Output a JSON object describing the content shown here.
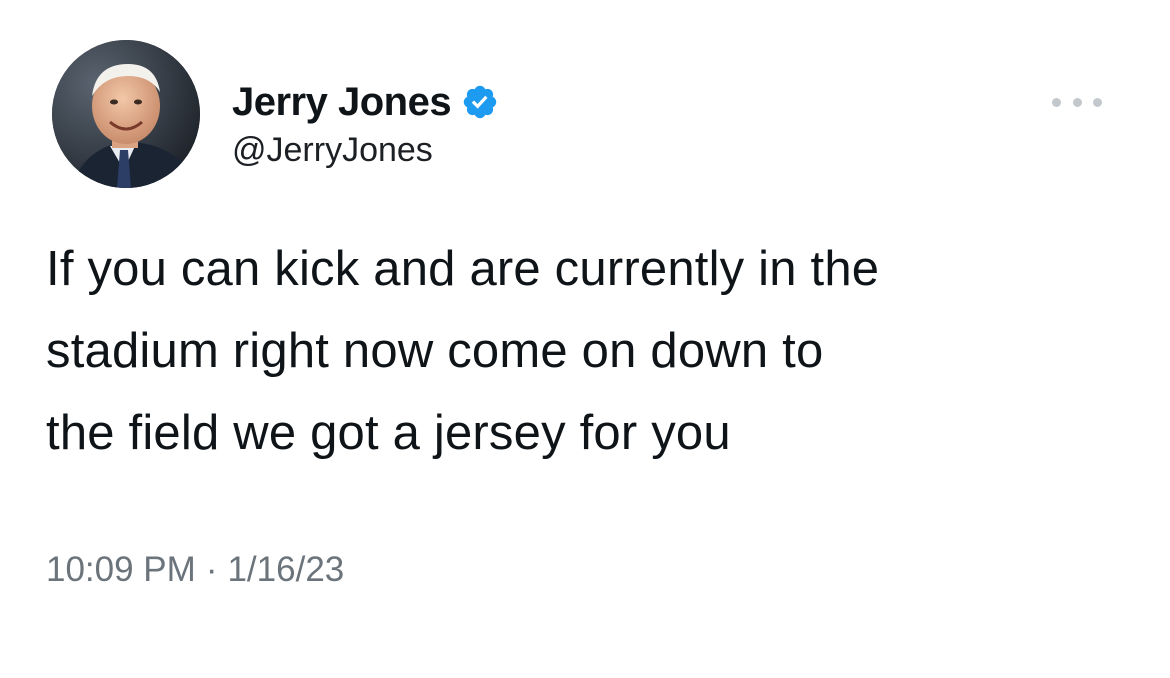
{
  "author": {
    "display_name": "Jerry Jones",
    "handle": "@JerryJones",
    "verified": true,
    "verified_color": "#1d9bf0"
  },
  "tweet": {
    "text": "If you can kick and are currently in the\nstadium right now come on down to\nthe field we got a jersey for you",
    "time": "10:09 PM",
    "separator": "·",
    "date": "1/16/23"
  },
  "icons": {
    "verified": "verified-badge-icon",
    "more": "more-options-icon"
  },
  "colors": {
    "text": "#0f1419",
    "secondary_text": "#6b737b",
    "background": "#ffffff"
  }
}
